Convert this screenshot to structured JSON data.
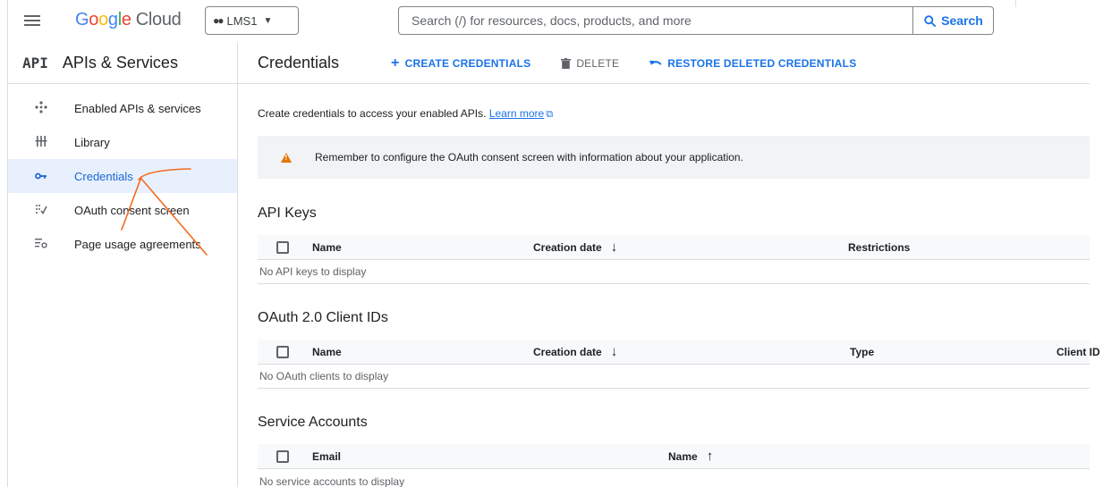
{
  "topbar": {
    "logo_google": [
      "G",
      "o",
      "o",
      "g",
      "l",
      "e"
    ],
    "logo_cloud": "Cloud",
    "project_name": "LMS1",
    "search_placeholder": "Search (/) for resources, docs, products, and more",
    "search_button": "Search"
  },
  "sidebar": {
    "badge": "API",
    "title": "APIs & Services",
    "items": [
      {
        "label": "Enabled APIs & services",
        "icon": "enabled-apis-icon",
        "active": false
      },
      {
        "label": "Library",
        "icon": "library-icon",
        "active": false
      },
      {
        "label": "Credentials",
        "icon": "key-icon",
        "active": true
      },
      {
        "label": "OAuth consent screen",
        "icon": "oauth-consent-icon",
        "active": false
      },
      {
        "label": "Page usage agreements",
        "icon": "settings-list-icon",
        "active": false
      }
    ]
  },
  "main": {
    "title": "Credentials",
    "actions": {
      "create": "CREATE CREDENTIALS",
      "delete": "DELETE",
      "restore": "RESTORE DELETED CREDENTIALS"
    },
    "intro_text": "Create credentials to access your enabled APIs.",
    "learn_more": "Learn more",
    "banner": "Remember to configure the OAuth consent screen with information about your application.",
    "api_keys": {
      "title": "API Keys",
      "col_name": "Name",
      "col_date": "Creation date",
      "col_restrictions": "Restrictions",
      "empty": "No API keys to display"
    },
    "oauth": {
      "title": "OAuth 2.0 Client IDs",
      "col_name": "Name",
      "col_date": "Creation date",
      "col_type": "Type",
      "col_client": "Client ID",
      "empty": "No OAuth clients to display"
    },
    "service_accounts": {
      "title": "Service Accounts",
      "col_email": "Email",
      "col_name": "Name",
      "empty": "No service accounts to display"
    }
  },
  "colors": {
    "accent_blue": "#1a73e8",
    "active_bg": "#e8f0fe",
    "warning_orange": "#e37400",
    "annotation_orange": "#f26b1d"
  }
}
